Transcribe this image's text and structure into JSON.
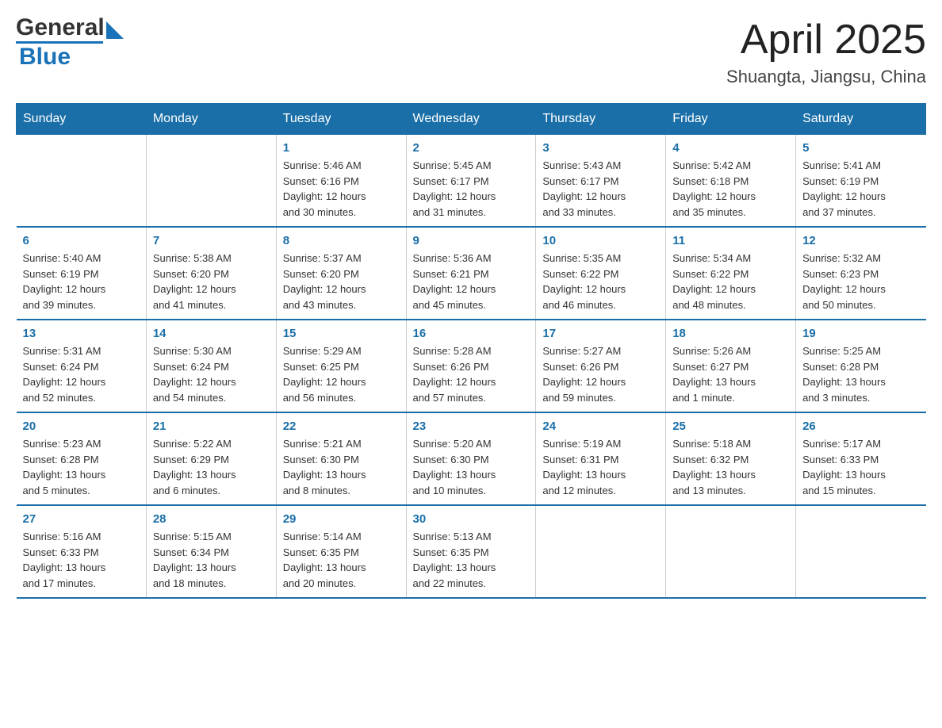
{
  "header": {
    "logo": {
      "general": "General",
      "arrow": "▶",
      "blue": "Blue"
    },
    "title": "April 2025",
    "subtitle": "Shuangta, Jiangsu, China"
  },
  "days": [
    "Sunday",
    "Monday",
    "Tuesday",
    "Wednesday",
    "Thursday",
    "Friday",
    "Saturday"
  ],
  "weeks": [
    [
      {
        "num": "",
        "info": ""
      },
      {
        "num": "",
        "info": ""
      },
      {
        "num": "1",
        "info": "Sunrise: 5:46 AM\nSunset: 6:16 PM\nDaylight: 12 hours\nand 30 minutes."
      },
      {
        "num": "2",
        "info": "Sunrise: 5:45 AM\nSunset: 6:17 PM\nDaylight: 12 hours\nand 31 minutes."
      },
      {
        "num": "3",
        "info": "Sunrise: 5:43 AM\nSunset: 6:17 PM\nDaylight: 12 hours\nand 33 minutes."
      },
      {
        "num": "4",
        "info": "Sunrise: 5:42 AM\nSunset: 6:18 PM\nDaylight: 12 hours\nand 35 minutes."
      },
      {
        "num": "5",
        "info": "Sunrise: 5:41 AM\nSunset: 6:19 PM\nDaylight: 12 hours\nand 37 minutes."
      }
    ],
    [
      {
        "num": "6",
        "info": "Sunrise: 5:40 AM\nSunset: 6:19 PM\nDaylight: 12 hours\nand 39 minutes."
      },
      {
        "num": "7",
        "info": "Sunrise: 5:38 AM\nSunset: 6:20 PM\nDaylight: 12 hours\nand 41 minutes."
      },
      {
        "num": "8",
        "info": "Sunrise: 5:37 AM\nSunset: 6:20 PM\nDaylight: 12 hours\nand 43 minutes."
      },
      {
        "num": "9",
        "info": "Sunrise: 5:36 AM\nSunset: 6:21 PM\nDaylight: 12 hours\nand 45 minutes."
      },
      {
        "num": "10",
        "info": "Sunrise: 5:35 AM\nSunset: 6:22 PM\nDaylight: 12 hours\nand 46 minutes."
      },
      {
        "num": "11",
        "info": "Sunrise: 5:34 AM\nSunset: 6:22 PM\nDaylight: 12 hours\nand 48 minutes."
      },
      {
        "num": "12",
        "info": "Sunrise: 5:32 AM\nSunset: 6:23 PM\nDaylight: 12 hours\nand 50 minutes."
      }
    ],
    [
      {
        "num": "13",
        "info": "Sunrise: 5:31 AM\nSunset: 6:24 PM\nDaylight: 12 hours\nand 52 minutes."
      },
      {
        "num": "14",
        "info": "Sunrise: 5:30 AM\nSunset: 6:24 PM\nDaylight: 12 hours\nand 54 minutes."
      },
      {
        "num": "15",
        "info": "Sunrise: 5:29 AM\nSunset: 6:25 PM\nDaylight: 12 hours\nand 56 minutes."
      },
      {
        "num": "16",
        "info": "Sunrise: 5:28 AM\nSunset: 6:26 PM\nDaylight: 12 hours\nand 57 minutes."
      },
      {
        "num": "17",
        "info": "Sunrise: 5:27 AM\nSunset: 6:26 PM\nDaylight: 12 hours\nand 59 minutes."
      },
      {
        "num": "18",
        "info": "Sunrise: 5:26 AM\nSunset: 6:27 PM\nDaylight: 13 hours\nand 1 minute."
      },
      {
        "num": "19",
        "info": "Sunrise: 5:25 AM\nSunset: 6:28 PM\nDaylight: 13 hours\nand 3 minutes."
      }
    ],
    [
      {
        "num": "20",
        "info": "Sunrise: 5:23 AM\nSunset: 6:28 PM\nDaylight: 13 hours\nand 5 minutes."
      },
      {
        "num": "21",
        "info": "Sunrise: 5:22 AM\nSunset: 6:29 PM\nDaylight: 13 hours\nand 6 minutes."
      },
      {
        "num": "22",
        "info": "Sunrise: 5:21 AM\nSunset: 6:30 PM\nDaylight: 13 hours\nand 8 minutes."
      },
      {
        "num": "23",
        "info": "Sunrise: 5:20 AM\nSunset: 6:30 PM\nDaylight: 13 hours\nand 10 minutes."
      },
      {
        "num": "24",
        "info": "Sunrise: 5:19 AM\nSunset: 6:31 PM\nDaylight: 13 hours\nand 12 minutes."
      },
      {
        "num": "25",
        "info": "Sunrise: 5:18 AM\nSunset: 6:32 PM\nDaylight: 13 hours\nand 13 minutes."
      },
      {
        "num": "26",
        "info": "Sunrise: 5:17 AM\nSunset: 6:33 PM\nDaylight: 13 hours\nand 15 minutes."
      }
    ],
    [
      {
        "num": "27",
        "info": "Sunrise: 5:16 AM\nSunset: 6:33 PM\nDaylight: 13 hours\nand 17 minutes."
      },
      {
        "num": "28",
        "info": "Sunrise: 5:15 AM\nSunset: 6:34 PM\nDaylight: 13 hours\nand 18 minutes."
      },
      {
        "num": "29",
        "info": "Sunrise: 5:14 AM\nSunset: 6:35 PM\nDaylight: 13 hours\nand 20 minutes."
      },
      {
        "num": "30",
        "info": "Sunrise: 5:13 AM\nSunset: 6:35 PM\nDaylight: 13 hours\nand 22 minutes."
      },
      {
        "num": "",
        "info": ""
      },
      {
        "num": "",
        "info": ""
      },
      {
        "num": "",
        "info": ""
      }
    ]
  ]
}
